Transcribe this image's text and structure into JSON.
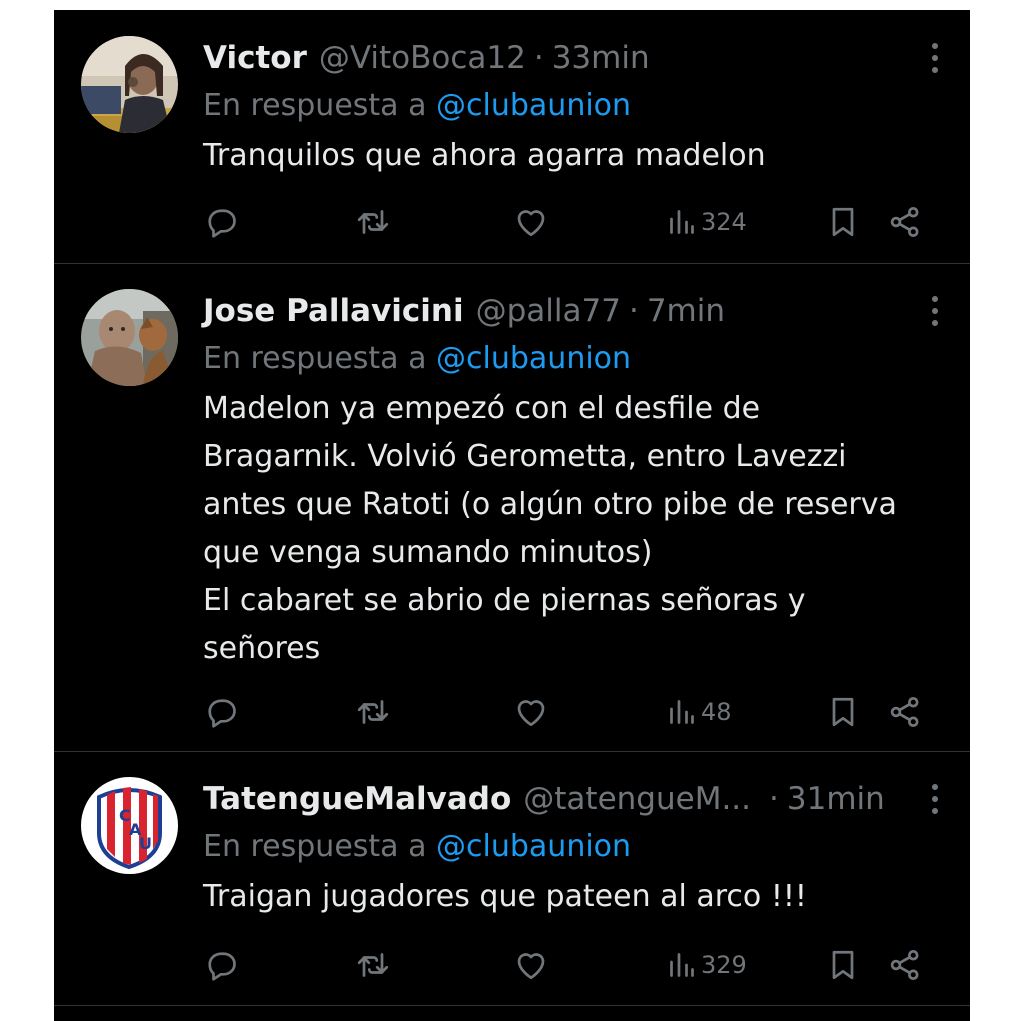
{
  "tweets": [
    {
      "display_name": "Victor",
      "handle": "@VitoBoca12",
      "separator": "·",
      "time": "33min",
      "reply_prefix": "En respuesta a",
      "reply_to": "@clubaunion",
      "text": "Tranquilos que ahora agarra madelon",
      "views": "324"
    },
    {
      "display_name": "Jose Pallavicini",
      "handle": "@palla77",
      "separator": "·",
      "time": "7min",
      "reply_prefix": "En respuesta a",
      "reply_to": "@clubaunion",
      "text": "Madelon ya empezó con el desfile de\nBragarnik. Volvió Gerometta, entro Lavezzi\nantes que Ratoti (o algún otro pibe de reserva\nque venga sumando minutos)\nEl cabaret se abrio de piernas señoras y\nseñores",
      "views": "48"
    },
    {
      "display_name": "TatengueMalvado",
      "handle": "@tatengueM...",
      "separator": "·",
      "time": "31min",
      "reply_prefix": "En respuesta a",
      "reply_to": "@clubaunion",
      "text": "Traigan jugadores que pateen al arco !!!",
      "views": "329"
    }
  ],
  "colors": {
    "background": "#000000",
    "text": "#e7e9ea",
    "muted": "#71767b",
    "link": "#1d9bf0",
    "divider": "#2f3336"
  },
  "icons": [
    "more-vertical-icon",
    "reply-icon",
    "retweet-icon",
    "like-icon",
    "views-icon",
    "bookmark-icon",
    "share-icon"
  ]
}
